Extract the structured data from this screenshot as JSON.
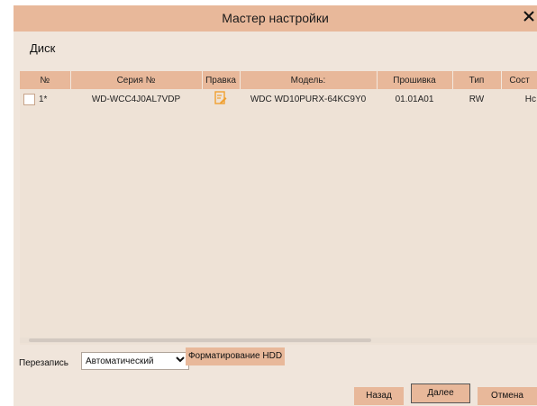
{
  "dialog": {
    "title": "Мастер настройки",
    "close": "✕",
    "section_label": "Диск"
  },
  "table": {
    "headers": {
      "num": "№",
      "serial": "Серия №",
      "edit": "Правка",
      "model": "Модель:",
      "firmware": "Прошивка",
      "type": "Тип",
      "state": "Сост"
    },
    "rows": [
      {
        "num": "1*",
        "serial": "WD-WCC4J0AL7VDP",
        "model": "WDC WD10PURX-64KC9Y0",
        "firmware": "01.01A01",
        "type": "RW",
        "state": "Нс"
      }
    ]
  },
  "controls": {
    "overwrite_label": "Перезапись",
    "overwrite_value": "Автоматический",
    "format_button": "Форматирование HDD",
    "back_button": "Назад",
    "next_button": "Далее",
    "cancel_button": "Отмена"
  },
  "colors": {
    "accent": "#e8b89a",
    "background": "#f0e5db",
    "edit_icon": "#f0a030"
  },
  "icons": {
    "edit": "edit-icon",
    "close": "close-icon",
    "dropdown": "chevron-down-icon"
  }
}
